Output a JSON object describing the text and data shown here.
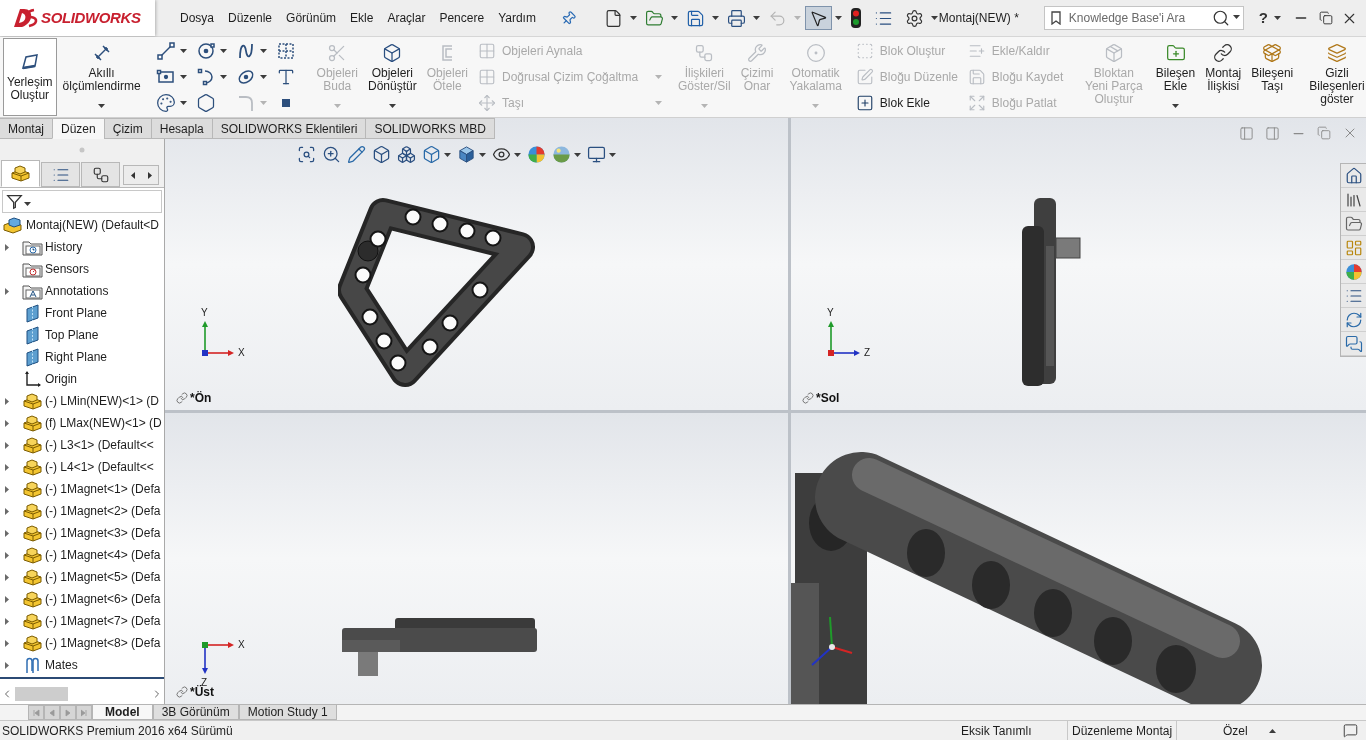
{
  "title_bar": {
    "logo": "SOLIDWORKS",
    "menu": [
      "Dosya",
      "Düzenle",
      "Görünüm",
      "Ekle",
      "Araçlar",
      "Pencere",
      "Yardım"
    ],
    "quick_access": [
      {
        "dropdown": true,
        "disabled": false,
        "selected": false
      },
      {
        "dropdown": true,
        "disabled": false,
        "selected": false
      },
      {
        "dropdown": true,
        "disabled": false,
        "selected": false
      },
      {
        "dropdown": true,
        "disabled": false,
        "selected": false
      },
      {
        "dropdown": true,
        "disabled": true,
        "selected": false
      },
      {
        "dropdown": true,
        "disabled": false,
        "selected": true
      },
      {
        "dropdown": false,
        "disabled": false,
        "selected": false
      },
      {
        "dropdown": false,
        "disabled": false,
        "selected": false
      },
      {
        "dropdown": true,
        "disabled": false,
        "selected": false
      }
    ],
    "document_title": "Montaj(NEW) *",
    "search": {
      "placeholder": "Knowledge Base'i Ara"
    },
    "help": "?"
  },
  "ribbon": {
    "groups": [
      {
        "sections": [
          {
            "kind": "large",
            "items": [
              {
                "label": "Yerleşim Oluştur",
                "active": true,
                "disabled": false,
                "dropdown": false
              },
              {
                "label": "Akıllı ölçümlendirme",
                "active": false,
                "disabled": false,
                "dropdown": true
              }
            ]
          }
        ]
      },
      {
        "sections": [
          {
            "kind": "grid",
            "items": [
              {
                "dropdown": true,
                "disabled": false
              },
              {
                "dropdown": true,
                "disabled": false
              },
              {
                "dropdown": true,
                "disabled": false
              },
              {
                "dropdown": false,
                "disabled": false
              },
              {
                "dropdown": true,
                "disabled": false
              },
              {
                "dropdown": true,
                "disabled": false
              },
              {
                "dropdown": true,
                "disabled": false
              },
              {
                "dropdown": false,
                "disabled": false
              },
              {
                "dropdown": true,
                "disabled": false
              },
              {
                "dropdown": false,
                "disabled": false
              },
              {
                "dropdown": true,
                "disabled": true
              },
              {
                "dropdown": false,
                "disabled": false
              }
            ]
          }
        ]
      },
      {
        "sections": [
          {
            "kind": "large",
            "items": [
              {
                "label": "Objeleri Buda",
                "active": false,
                "disabled": true,
                "dropdown": true
              },
              {
                "label": "Objeleri Dönüştür",
                "active": false,
                "disabled": false,
                "dropdown": true
              },
              {
                "label": "Objeleri Ötele",
                "active": false,
                "disabled": true,
                "dropdown": false
              }
            ]
          },
          {
            "kind": "small",
            "items": [
              {
                "label": "Objeleri Aynala",
                "disabled": true,
                "dropdown": false
              },
              {
                "label": "Doğrusal Çizim Çoğaltma",
                "disabled": true,
                "dropdown": true
              },
              {
                "label": "Taşı",
                "disabled": true,
                "dropdown": true
              }
            ]
          }
        ]
      },
      {
        "sections": [
          {
            "kind": "large",
            "items": [
              {
                "label": "İlişkileri Göster/Sil",
                "active": false,
                "disabled": true,
                "dropdown": true
              },
              {
                "label": "Çizimi Onar",
                "active": false,
                "disabled": true,
                "dropdown": false
              }
            ]
          }
        ]
      },
      {
        "sections": [
          {
            "kind": "large",
            "items": [
              {
                "label": "Otomatik Yakalama",
                "active": false,
                "disabled": true,
                "dropdown": true
              }
            ]
          }
        ]
      },
      {
        "sections": [
          {
            "kind": "small",
            "items": [
              {
                "label": "Blok Oluştur",
                "disabled": true,
                "dropdown": false
              },
              {
                "label": "Bloğu Düzenle",
                "disabled": true,
                "dropdown": false
              },
              {
                "label": "Blok Ekle",
                "disabled": false,
                "dropdown": false
              }
            ]
          },
          {
            "kind": "small",
            "items": [
              {
                "label": "Ekle/Kaldır",
                "disabled": true,
                "dropdown": false
              },
              {
                "label": "Bloğu Kaydet",
                "disabled": true,
                "dropdown": false
              },
              {
                "label": "Bloğu Patlat",
                "disabled": true,
                "dropdown": false
              }
            ]
          }
        ]
      },
      {
        "sections": [
          {
            "kind": "large",
            "items": [
              {
                "label": "Bloktan Yeni Parça Oluştur",
                "active": false,
                "disabled": true,
                "dropdown": false
              },
              {
                "label": "Bileşen Ekle",
                "active": false,
                "disabled": false,
                "dropdown": true
              },
              {
                "label": "Montaj İlişkisi",
                "active": false,
                "disabled": false,
                "dropdown": false
              },
              {
                "label": "Bileşeni Taşı",
                "active": false,
                "disabled": false,
                "dropdown": false
              }
            ]
          }
        ]
      },
      {
        "sections": [
          {
            "kind": "large",
            "items": [
              {
                "label": "Gizli Bileşenleri göster",
                "active": false,
                "disabled": false,
                "dropdown": false
              }
            ]
          }
        ]
      }
    ]
  },
  "command_tabs": [
    {
      "label": "Montaj",
      "selected": false
    },
    {
      "label": "Düzen",
      "selected": true
    },
    {
      "label": "Çizim",
      "selected": false
    },
    {
      "label": "Hesapla",
      "selected": false
    },
    {
      "label": "SOLIDWORKS Eklentileri",
      "selected": false
    },
    {
      "label": "SOLIDWORKS MBD",
      "selected": false
    }
  ],
  "feature_manager": {
    "tabs": [
      {
        "selected": true
      },
      {
        "selected": false
      },
      {
        "selected": false
      }
    ],
    "tree": {
      "label": "Montaj(NEW) (Default<D",
      "kind": "assembly",
      "children": [
        {
          "label": "History",
          "kind": "history",
          "expandable": true
        },
        {
          "label": "Sensors",
          "kind": "sensors",
          "expandable": false
        },
        {
          "label": "Annotations",
          "kind": "annotations",
          "expandable": true
        },
        {
          "label": "Front Plane",
          "kind": "plane",
          "expandable": false
        },
        {
          "label": "Top Plane",
          "kind": "plane",
          "expandable": false
        },
        {
          "label": "Right Plane",
          "kind": "plane",
          "expandable": false
        },
        {
          "label": "Origin",
          "kind": "origin",
          "expandable": false
        },
        {
          "label": "(-) LMin(NEW)<1> (D",
          "kind": "component",
          "expandable": true
        },
        {
          "label": "(f) LMax(NEW)<1> (D",
          "kind": "component",
          "expandable": true
        },
        {
          "label": "(-) L3<1> (Default<<",
          "kind": "component",
          "expandable": true
        },
        {
          "label": "(-) L4<1> (Default<<",
          "kind": "component",
          "expandable": true
        },
        {
          "label": "(-) 1Magnet<1> (Defa",
          "kind": "component",
          "expandable": true
        },
        {
          "label": "(-) 1Magnet<2> (Defa",
          "kind": "component",
          "expandable": true
        },
        {
          "label": "(-) 1Magnet<3> (Defa",
          "kind": "component",
          "expandable": true
        },
        {
          "label": "(-) 1Magnet<4> (Defa",
          "kind": "component",
          "expandable": true
        },
        {
          "label": "(-) 1Magnet<5> (Defa",
          "kind": "component",
          "expandable": true
        },
        {
          "label": "(-) 1Magnet<6> (Defa",
          "kind": "component",
          "expandable": true
        },
        {
          "label": "(-) 1Magnet<7> (Defa",
          "kind": "component",
          "expandable": true
        },
        {
          "label": "(-) 1Magnet<8> (Defa",
          "kind": "component",
          "expandable": true
        },
        {
          "label": "Mates",
          "kind": "mates",
          "expandable": true
        }
      ]
    }
  },
  "viewport": {
    "view_toolbar": [
      {
        "dropdown": false
      },
      {
        "dropdown": false
      },
      {
        "dropdown": false
      },
      {
        "dropdown": false
      },
      {
        "dropdown": false
      },
      {
        "dropdown": true
      },
      {
        "dropdown": true
      },
      {
        "dropdown": true
      },
      {
        "dropdown": false
      },
      {
        "dropdown": true
      },
      {
        "dropdown": true
      }
    ],
    "views": [
      {
        "kind": "front",
        "label": "*Ön",
        "triad": {
          "vertical": "Y",
          "horizontal": "X"
        }
      },
      {
        "kind": "side",
        "label": "*Sol",
        "triad": {
          "vertical": "Y",
          "horizontal": "Z"
        }
      },
      {
        "kind": "top",
        "label": "*Üst",
        "triad": {
          "vertical": "Z",
          "horizontal": "X"
        }
      },
      {
        "kind": "iso"
      }
    ]
  },
  "sheet_tabs": [
    {
      "label": "Model",
      "selected": true
    },
    {
      "label": "3B Görünüm",
      "selected": false
    },
    {
      "label": "Motion Study 1",
      "selected": false
    }
  ],
  "status_bar": {
    "edition": "SOLIDWORKS Premium 2016 x64 Sürümü",
    "fields": [
      "Eksik Tanımlı",
      "Düzenleme Montaj",
      "Özel"
    ]
  }
}
